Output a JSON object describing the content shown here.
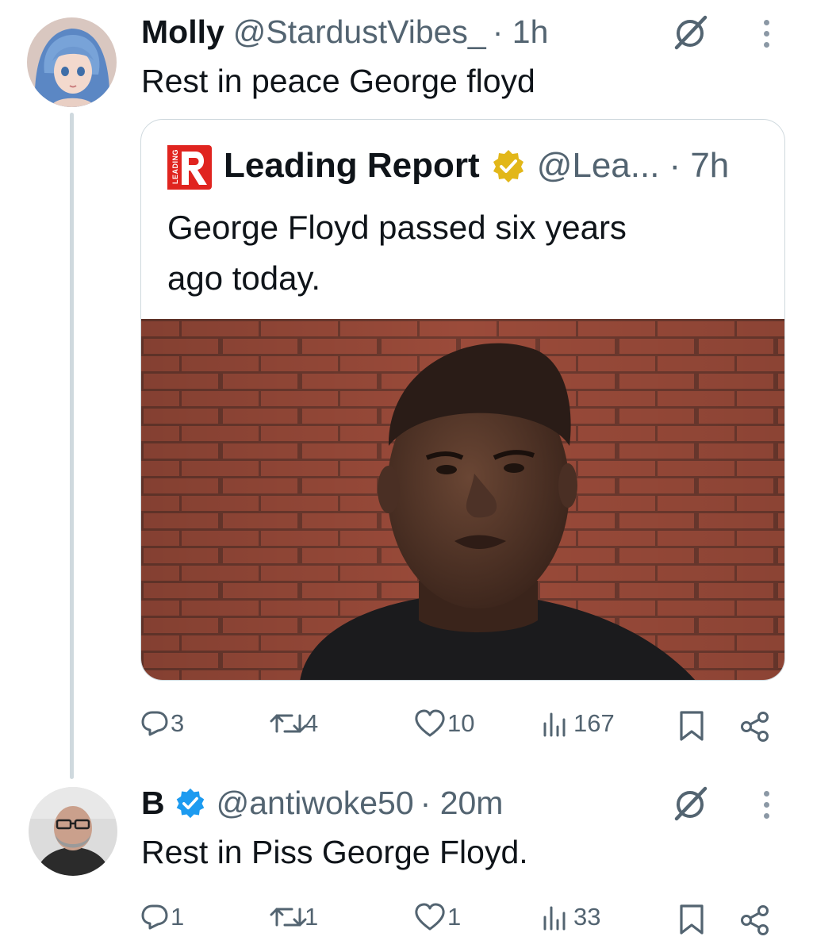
{
  "reply1": {
    "name": "Molly",
    "handle": "@StardustVibes_",
    "time": "· 1h",
    "text": "Rest in peace George floyd"
  },
  "quote": {
    "logo_letter": "R",
    "logo_side_text": "LEADING",
    "name": "Leading Report",
    "handle": "@Lea...",
    "time": "· 7h",
    "text_line1": "George Floyd passed six years",
    "text_line2": "ago today."
  },
  "actions1": {
    "replies": "3",
    "reposts": "4",
    "likes": "10",
    "views": "167"
  },
  "reply2": {
    "name": "B",
    "handle": "@antiwoke50",
    "time": "· 20m",
    "text": "Rest in Piss George Floyd."
  },
  "actions2": {
    "replies": "1",
    "reposts": "1",
    "likes": "1",
    "views": "33"
  },
  "colors": {
    "text": "#0f1419",
    "secondary": "#536471",
    "gold_badge": "#e2b719",
    "blue_badge": "#1d9bf0",
    "brand_red": "#e0241f",
    "thread_line": "#cfd9de"
  },
  "icons": [
    "grok-icon",
    "more-icon",
    "gold-verified-icon",
    "blue-verified-icon",
    "reply-icon",
    "repost-icon",
    "like-icon",
    "views-icon",
    "bookmark-icon",
    "share-icon"
  ]
}
